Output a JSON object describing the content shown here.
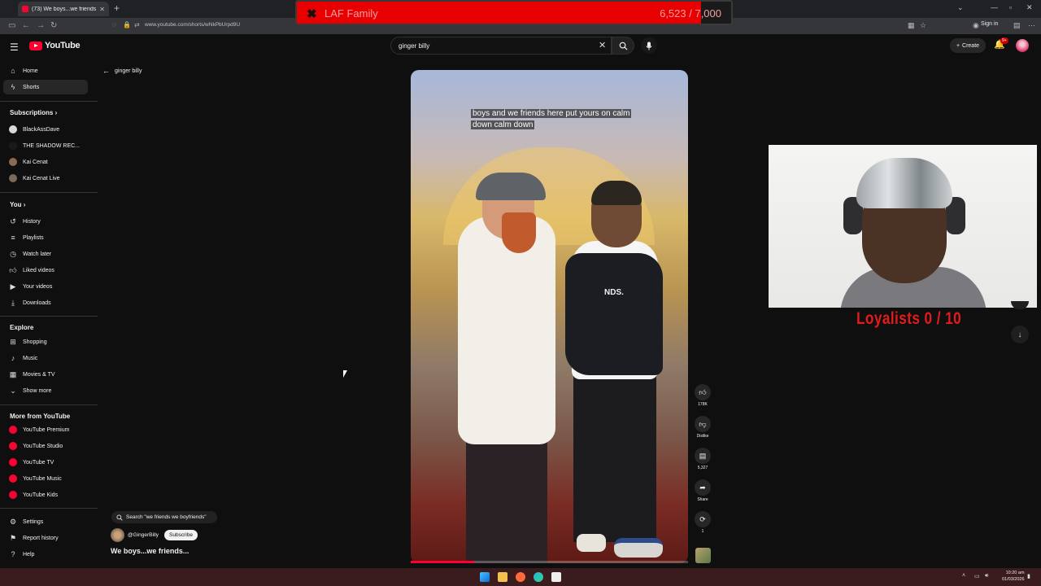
{
  "browser": {
    "tab_title": "(73) We boys...we friends...",
    "url": "www.youtube.com/shorts/wNkPbUrpd9U",
    "sign_in": "Sign in"
  },
  "overlay": {
    "name": "LAF Family",
    "count": "6,523 / 7,000",
    "progress": 0.93,
    "loyalists": "Loyalists  0 / 10"
  },
  "header": {
    "logo": "YouTube",
    "search_value": "ginger billy",
    "create_label": "Create",
    "notif_badge": "9+"
  },
  "sidebar": {
    "top": [
      {
        "label": "Home",
        "icon": "home-icon",
        "active": false
      },
      {
        "label": "Shorts",
        "icon": "shorts-icon",
        "active": true
      }
    ],
    "subscriptions_title": "Subscriptions",
    "subscriptions": [
      {
        "label": "BlackAssDave",
        "color": "#d8d8d8"
      },
      {
        "label": "THE SHADOW REC...",
        "color": "#1a1a1a"
      },
      {
        "label": "Kai Cenat",
        "color": "#8a6a50"
      },
      {
        "label": "Kai Cenat Live",
        "color": "#7a6a5a"
      }
    ],
    "you_title": "You",
    "you": [
      {
        "label": "History",
        "icon": "history-icon"
      },
      {
        "label": "Playlists",
        "icon": "playlists-icon"
      },
      {
        "label": "Watch later",
        "icon": "clock-icon"
      },
      {
        "label": "Liked videos",
        "icon": "thumbs-up-icon"
      },
      {
        "label": "Your videos",
        "icon": "your-videos-icon"
      },
      {
        "label": "Downloads",
        "icon": "download-icon"
      }
    ],
    "explore_title": "Explore",
    "explore": [
      {
        "label": "Shopping",
        "icon": "shopping-bag-icon"
      },
      {
        "label": "Music",
        "icon": "music-note-icon"
      },
      {
        "label": "Movies & TV",
        "icon": "film-icon"
      },
      {
        "label": "Show more",
        "icon": "chevron-down-icon"
      }
    ],
    "more_title": "More from YouTube",
    "more": [
      {
        "label": "YouTube Premium"
      },
      {
        "label": "YouTube Studio"
      },
      {
        "label": "YouTube TV"
      },
      {
        "label": "YouTube Music"
      },
      {
        "label": "YouTube Kids"
      }
    ],
    "bottom": [
      {
        "label": "Settings",
        "icon": "gear-icon"
      },
      {
        "label": "Report history",
        "icon": "flag-icon"
      },
      {
        "label": "Help",
        "icon": "help-icon"
      }
    ]
  },
  "back_label": "ginger billy",
  "video": {
    "caption": "boys and we friends here put yours on calm down calm down",
    "garment_text": "NDS.",
    "progress": 0.23
  },
  "actions": {
    "like_count": "178K",
    "dislike_label": "Dislike",
    "comment_count": "5,327",
    "share_label": "Share",
    "remix_count": "1"
  },
  "short_info": {
    "search_chip": "Search \"we friends we boyfriends\"",
    "channel": "@GingerBilly",
    "subscribe": "Subscribe",
    "title": "We boys...we friends..."
  },
  "taskbar": {
    "time": "10:20 am",
    "date": "01/03/2026"
  }
}
